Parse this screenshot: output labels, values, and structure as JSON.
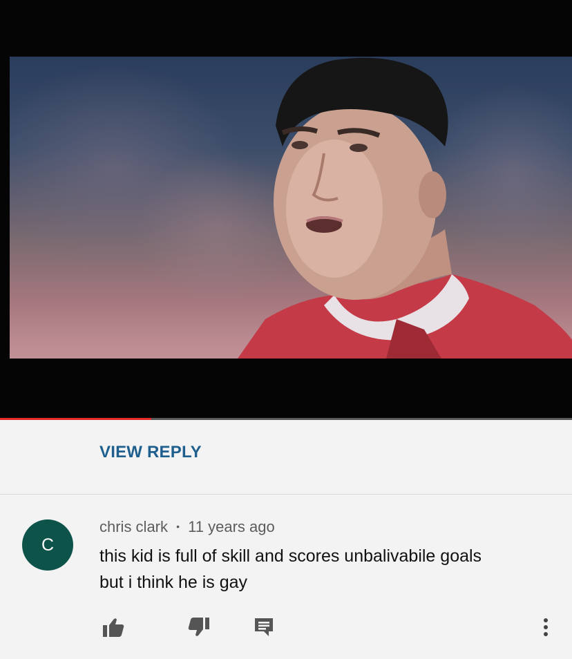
{
  "video": {
    "progress": 0.265,
    "progress_color": "#e52d27"
  },
  "replies": {
    "view_reply_label": "VIEW REPLY"
  },
  "comment": {
    "avatar_letter": "C",
    "avatar_color": "#0e5349",
    "author": "chris clark",
    "separator": "•",
    "time": "11 years ago",
    "text_line1": "this kid is full of skill and scores unbalivabile goals",
    "text_line2": "but i think he is gay"
  },
  "actions": {
    "like_icon": "thumbs-up-icon",
    "dislike_icon": "thumbs-down-icon",
    "reply_icon": "comment-icon",
    "more_icon": "more-vertical-icon"
  },
  "accent_link_color": "#1f5f8e"
}
